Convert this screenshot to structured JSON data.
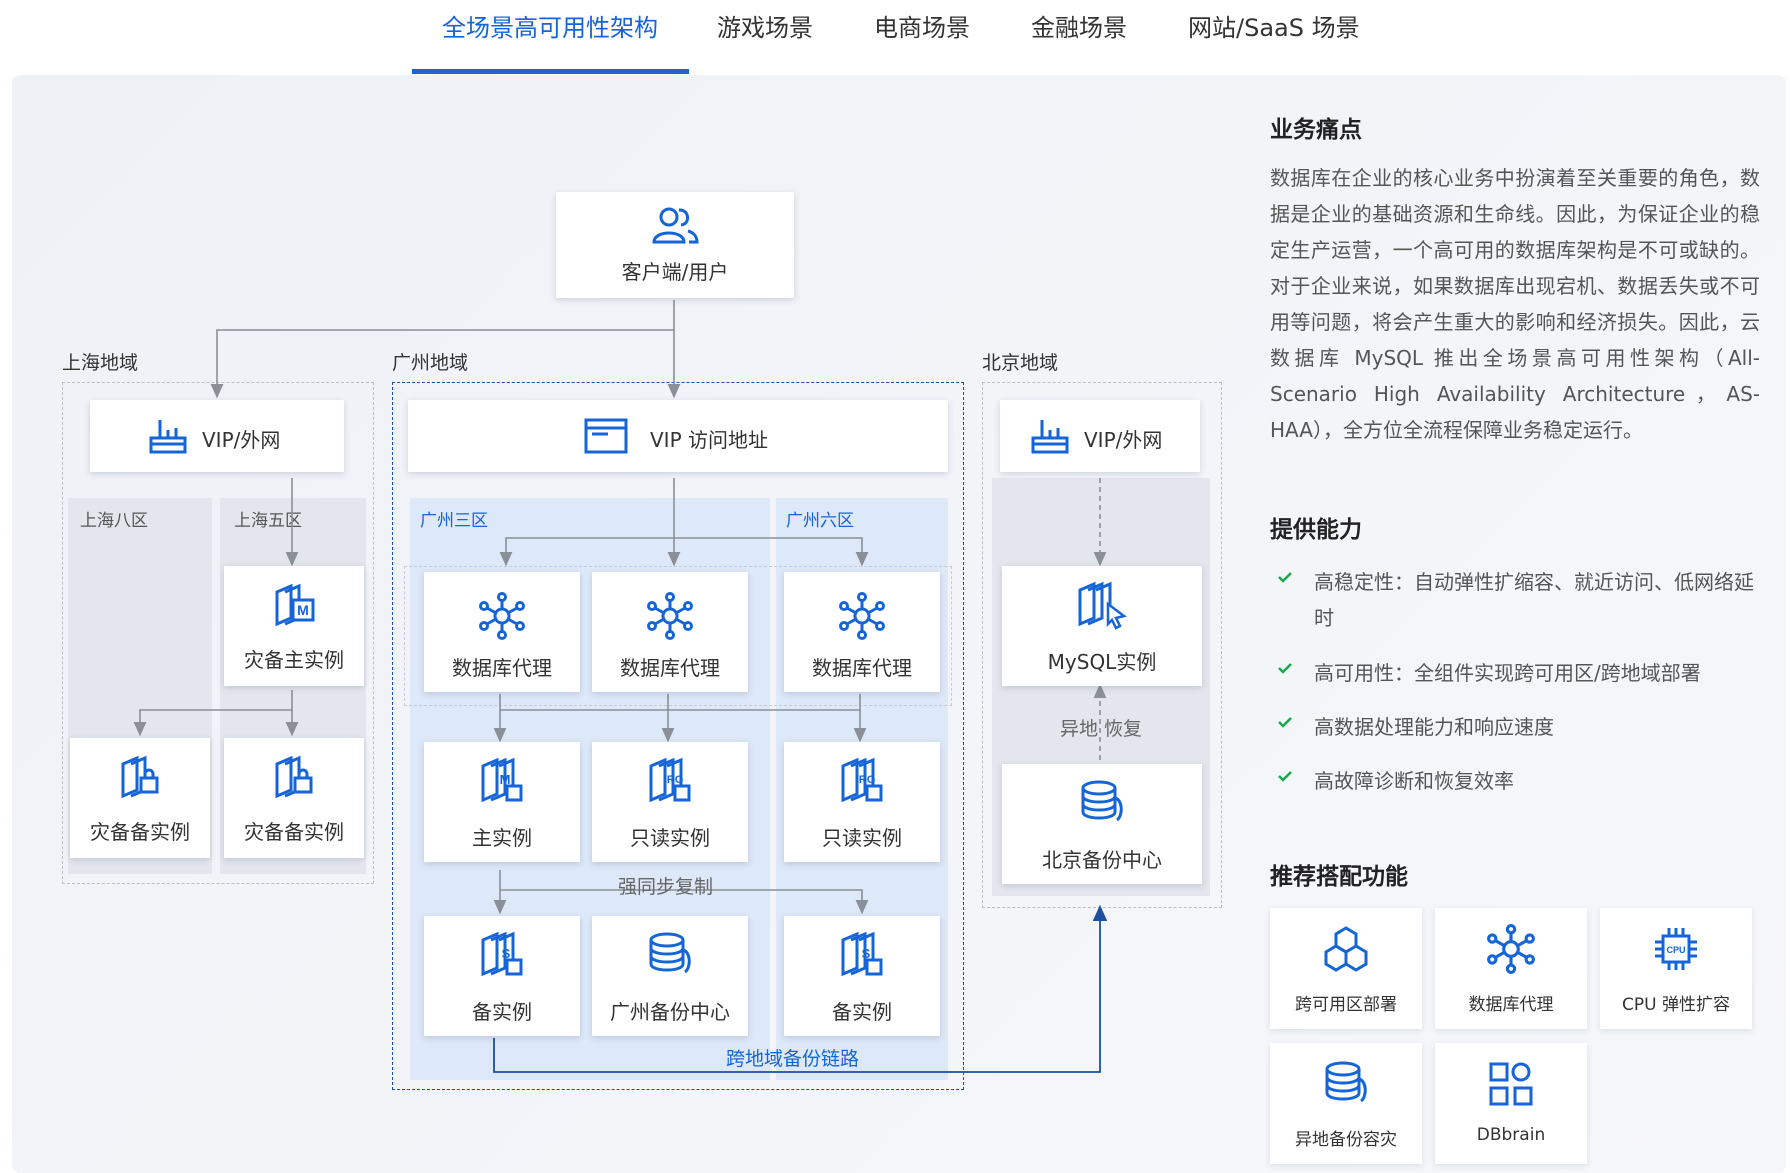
{
  "tabs": [
    {
      "label": "全场景高可用性架构",
      "active": true
    },
    {
      "label": "游戏场景"
    },
    {
      "label": "电商场景"
    },
    {
      "label": "金融场景"
    },
    {
      "label": "网站/SaaS 场景"
    }
  ],
  "diagram": {
    "client": "客户端/用户",
    "regions": {
      "shanghai": "上海地域",
      "guangzhou": "广州地域",
      "beijing": "北京地域"
    },
    "vip_shanghai": "VIP/外网",
    "vip_guangzhou": "VIP 访问地址",
    "vip_beijing": "VIP/外网",
    "zones": {
      "sh8": "上海八区",
      "sh5": "上海五区",
      "gz3": "广州三区",
      "gz6": "广州六区"
    },
    "sh_primary": "灾备主实例",
    "sh_standby_1": "灾备备实例",
    "sh_standby_2": "灾备备实例",
    "proxy_1": "数据库代理",
    "proxy_2": "数据库代理",
    "proxy_3": "数据库代理",
    "gz_primary": "主实例",
    "gz_readonly_1": "只读实例",
    "gz_readonly_2": "只读实例",
    "strong_sync": "强同步复制",
    "gz_standby_1": "备实例",
    "gz_backup_center": "广州备份中心",
    "gz_standby_2": "备实例",
    "cross_region_backup": "跨地域备份链路",
    "bj_mysql": "MySQL实例",
    "bj_restore": "异地 恢复",
    "bj_backup_center": "北京备份中心"
  },
  "info": {
    "pain_title": "业务痛点",
    "pain_text": "数据库在企业的核心业务中扮演着至关重要的角色，数据是企业的基础资源和生命线。因此，为保证企业的稳定生产运营，一个高可用的数据库架构是不可或缺的。对于企业来说，如果数据库出现宕机、数据丢失或不可用等问题，将会产生重大的影响和经济损失。因此，云数据库 MySQL 推出全场景高可用性架构（All-Scenario High Availability Architecture，AS-HAA），全方位全流程保障业务稳定运行。",
    "capability_title": "提供能力",
    "capabilities": [
      "高稳定性：自动弹性扩缩容、就近访问、低网络延时",
      "高可用性：全组件实现跨可用区/跨地域部署",
      "高数据处理能力和响应速度",
      "高故障诊断和恢复效率"
    ],
    "recommend_title": "推荐搭配功能",
    "features": [
      {
        "label": "跨可用区部署",
        "icon": "cubes-icon"
      },
      {
        "label": "数据库代理",
        "icon": "network-hub-icon"
      },
      {
        "label": "CPU 弹性扩容",
        "icon": "cpu-chip-icon"
      },
      {
        "label": "异地备份容灾",
        "icon": "database-backup-icon"
      },
      {
        "label": "DBbrain",
        "icon": "dbbrain-grid-icon"
      }
    ]
  },
  "colors": {
    "accent": "#1565d8",
    "check": "#18a84c",
    "line": "#8a8f98",
    "blue_dash": "#1b4fa0"
  }
}
